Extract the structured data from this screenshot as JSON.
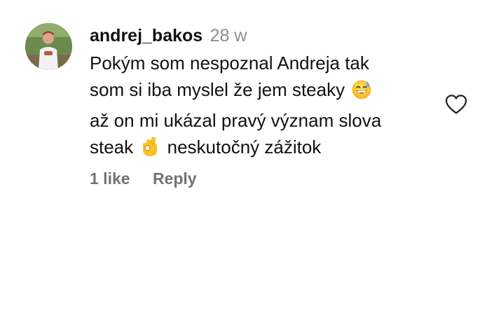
{
  "comment": {
    "username": "andrej_bakos",
    "time": "28 w",
    "lines": [
      "Pokým som nespoznal Andreja tak",
      "som si iba myslel že jem steaky",
      "až on mi ukázal pravý význam slova",
      "steak",
      "neskutočný zážitok"
    ],
    "emojis": {
      "line2": "grinning-face-with-sweat-icon",
      "line4": "ok-hand-icon"
    },
    "likes_label": "1 like",
    "reply_label": "Reply",
    "like_icon": "heart-outline-icon"
  }
}
